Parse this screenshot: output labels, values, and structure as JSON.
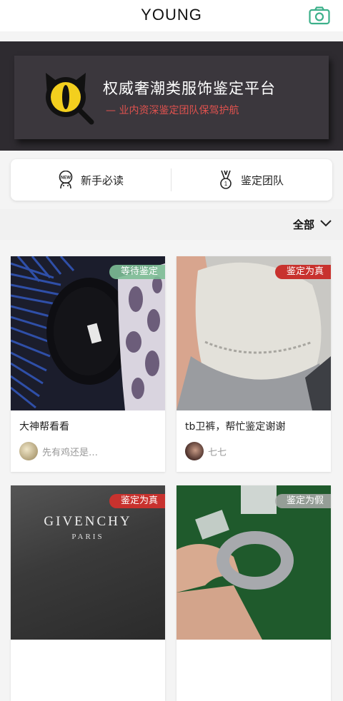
{
  "header": {
    "title": "YOUNG"
  },
  "banner": {
    "title": "权威奢潮类服饰鉴定平台",
    "subtitle": "— 业内资深鉴定团队保驾护航"
  },
  "quick_links": [
    {
      "label": "新手必读"
    },
    {
      "label": "鉴定团队"
    }
  ],
  "filter": {
    "selected": "全部"
  },
  "posts": [
    {
      "status": "等待鉴定",
      "title": "大神帮看看",
      "user": "先有鸡还是…"
    },
    {
      "status": "鉴定为真",
      "title": "tb卫裤，帮忙鉴定谢谢",
      "user": "七七"
    },
    {
      "status": "鉴定为真",
      "title": "",
      "user": "",
      "image_text": [
        "GIVENCHY",
        "PARIS"
      ]
    },
    {
      "status": "鉴定为假",
      "title": "",
      "user": ""
    }
  ],
  "colors": {
    "accent_green": "#3cb08a",
    "status_real": "#c8322e",
    "status_wait": "#7dbe96",
    "status_fake": "#aaaaaa",
    "banner_subtitle": "#e0524e"
  }
}
